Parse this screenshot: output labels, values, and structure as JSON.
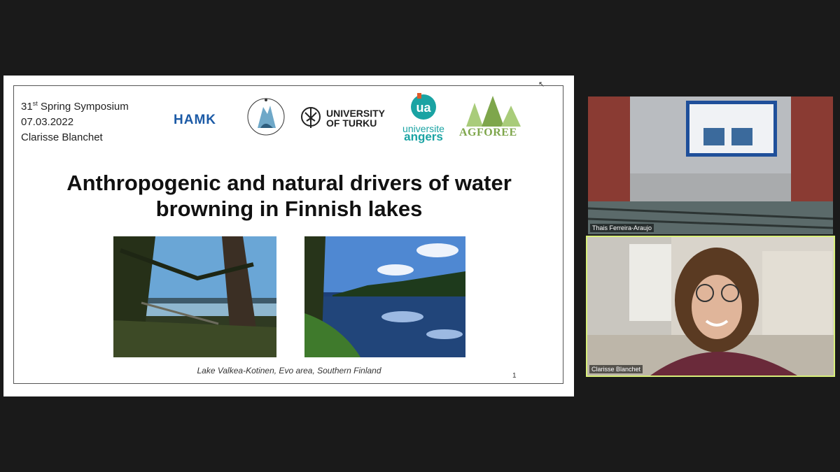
{
  "slide": {
    "meta_line1_num": "31",
    "meta_line1_sup": "st",
    "meta_line1_rest": " Spring Symposium",
    "meta_line2": "07.03.2022",
    "meta_line3": "Clarisse Blanchet",
    "title_line1": "Anthropogenic and natural drivers of water",
    "title_line2": "browning in Finnish lakes",
    "caption": "Lake Valkea-Kotinen, Evo area, Southern Finland",
    "page_number": "1",
    "logos": {
      "hamk": "HAMK",
      "turku_line1": "UNIVERSITY",
      "turku_line2": "OF TURKU",
      "angers_top": "universite",
      "angers_bottom": "angers",
      "agforee": "AGFOREE"
    }
  },
  "participants": [
    {
      "name": "Thais Ferreira-Araujo"
    },
    {
      "name": "Clarisse Blanchet"
    }
  ],
  "colors": {
    "background": "#1a1a1a",
    "active_speaker_border": "#d8f07a",
    "hamk_blue": "#1b5aa6",
    "angers_teal": "#1aa3a3",
    "agforee_green": "#7ea64b"
  }
}
